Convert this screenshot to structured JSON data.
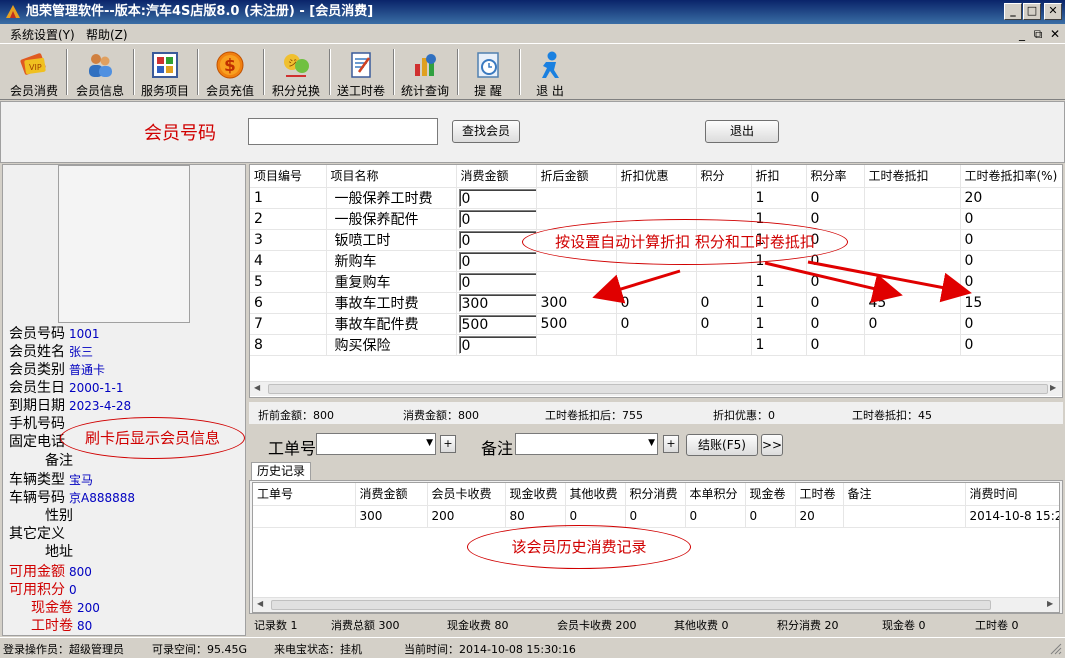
{
  "window": {
    "title": "旭荣管理软件--版本:汽车4S店版8.0 (未注册) - [会员消费]",
    "min": "_",
    "max": "□",
    "close": "✕"
  },
  "menu": {
    "items": [
      "系统设置(Y)",
      "帮助(Z)"
    ],
    "mdi": [
      "_",
      "⧉",
      "✕"
    ]
  },
  "toolbar": {
    "buttons": [
      {
        "label": "会员消费",
        "icon": "member-card-icon"
      },
      {
        "label": "会员信息",
        "icon": "users-icon"
      },
      {
        "label": "服务项目",
        "icon": "grid-icon"
      },
      {
        "label": "会员充值",
        "icon": "dollar-coin-icon"
      },
      {
        "label": "积分兑换",
        "icon": "points-exchange-icon"
      },
      {
        "label": "送工时卷",
        "icon": "clipboard-icon"
      },
      {
        "label": "统计查询",
        "icon": "statistics-icon"
      },
      {
        "label": "提  醒",
        "icon": "reminder-icon"
      },
      {
        "label": "退  出",
        "icon": "exit-person-icon"
      }
    ]
  },
  "search": {
    "label": "会员号码",
    "value": "",
    "find_button": "查找会员",
    "exit_button": "退出"
  },
  "member": {
    "fields": [
      {
        "label": "会员号码",
        "value": "1001",
        "label_color": "#000000"
      },
      {
        "label": "会员姓名",
        "value": "张三",
        "label_color": "#000000"
      },
      {
        "label": "会员类别",
        "value": "普通卡",
        "label_color": "#000000"
      },
      {
        "label": "会员生日",
        "value": "2000-1-1",
        "label_color": "#000000"
      },
      {
        "label": "到期日期",
        "value": "2023-4-28",
        "label_color": "#000000"
      },
      {
        "label": "手机号码",
        "value": "",
        "label_color": "#000000"
      },
      {
        "label": "固定电话",
        "value": "",
        "label_color": "#000000"
      },
      {
        "label": "备注",
        "value": "",
        "label_color": "#000000"
      },
      {
        "label": "车辆类型",
        "value": "宝马",
        "label_color": "#000000"
      },
      {
        "label": "车辆号码",
        "value": "京A888888",
        "label_color": "#000000"
      },
      {
        "label": "性别",
        "value": "",
        "label_color": "#000000"
      },
      {
        "label": "其它定义",
        "value": "",
        "label_color": "#000000"
      },
      {
        "label": "地址",
        "value": "",
        "label_color": "#000000"
      },
      {
        "label": "可用金额",
        "value": "800",
        "label_color": "#d00000"
      },
      {
        "label": "可用积分",
        "value": "0",
        "label_color": "#d00000"
      },
      {
        "label": "现金卷",
        "value": "200",
        "label_color": "#d00000"
      },
      {
        "label": "工时卷",
        "value": "80",
        "label_color": "#d00000"
      }
    ]
  },
  "items_grid": {
    "columns": [
      "项目编号",
      "项目名称",
      "消费金额",
      "折后金额",
      "折扣优惠",
      "积分",
      "折扣",
      "积分率",
      "工时卷抵扣",
      "工时卷抵扣率(%)"
    ],
    "rows": [
      [
        "1",
        "一般保养工时费",
        "0",
        "",
        "",
        "",
        "1",
        "0",
        "",
        "20"
      ],
      [
        "2",
        "一般保养配件",
        "0",
        "",
        "",
        "",
        "1",
        "0",
        "",
        "0"
      ],
      [
        "3",
        "钣喷工时",
        "0",
        "",
        "",
        "",
        "1",
        "0",
        "",
        "0"
      ],
      [
        "4",
        "新购车",
        "0",
        "",
        "",
        "",
        "1",
        "0",
        "",
        "0"
      ],
      [
        "5",
        "重复购车",
        "0",
        "",
        "",
        "",
        "1",
        "0",
        "",
        "0"
      ],
      [
        "6",
        "事故车工时费",
        "300",
        "300",
        "0",
        "0",
        "1",
        "0",
        "45",
        "15"
      ],
      [
        "7",
        "事故车配件费",
        "500",
        "500",
        "0",
        "0",
        "1",
        "0",
        "0",
        "0"
      ],
      [
        "8",
        "购买保险",
        "0",
        "",
        "",
        "",
        "1",
        "0",
        "",
        "0"
      ]
    ]
  },
  "summary1": [
    "折前金额：800",
    "消费金额：800",
    "工时卷抵扣后：755",
    "折扣优惠：0",
    "工时卷抵扣：45"
  ],
  "order": {
    "workorder_label": "工单号",
    "workorder_value": "",
    "remark_label": "备注",
    "remark_value": "",
    "plus": "+",
    "checkout_button": "结账(F5)",
    "more_button": ">>"
  },
  "history": {
    "tab": "历史记录",
    "columns": [
      "工单号",
      "消费金额",
      "会员卡收费",
      "现金收费",
      "其他收费",
      "积分消费",
      "本单积分",
      "现金卷",
      "工时卷",
      "备注",
      "消费时间"
    ],
    "rows": [
      [
        "",
        "300",
        "200",
        "80",
        "0",
        "0",
        "0",
        "0",
        "20",
        "",
        "2014-10-8 15:2"
      ]
    ]
  },
  "summary2": [
    "记录数 1",
    "消费总额 300",
    "现金收费 80",
    "会员卡收费 200",
    "其他收费 0",
    "积分消费 20",
    "现金卷 0",
    "工时卷 0"
  ],
  "status": [
    "登录操作员：超级管理员",
    "可录空间：95.45G",
    "来电宝状态：挂机",
    "当前时间：2014-10-08 15:30:16"
  ],
  "annotations": [
    "按设置自动计算折扣 积分和工时卷抵扣",
    "刷卡后显示会员信息",
    "该会员历史消费记录"
  ]
}
